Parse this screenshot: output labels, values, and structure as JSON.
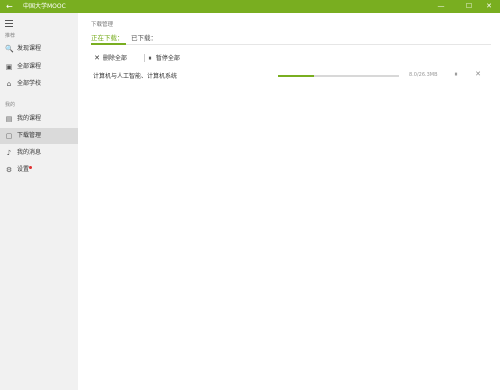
{
  "window": {
    "title": "中国大学MOOC",
    "back_icon": "←",
    "minimize_icon": "—",
    "maximize_icon": "☐",
    "close_icon": "✕",
    "accent_color": "#79ae20"
  },
  "sidebar": {
    "menu_icon": "hamburger-icon",
    "section_recommend": "推荐",
    "section_mine": "我的",
    "items": [
      {
        "label": "发现课程",
        "icon": "🔍",
        "icon_name": "search-icon"
      },
      {
        "label": "全部课程",
        "icon": "▣",
        "icon_name": "courses-icon"
      },
      {
        "label": "全部学校",
        "icon": "⌂",
        "icon_name": "school-icon"
      },
      {
        "label": "我的课程",
        "icon": "▤",
        "icon_name": "my-courses-icon"
      },
      {
        "label": "下载管理",
        "icon": "▢",
        "icon_name": "download-icon",
        "active": true
      },
      {
        "label": "我的消息",
        "icon": "♪",
        "icon_name": "bell-icon"
      },
      {
        "label": "设置",
        "icon": "⚙",
        "icon_name": "gear-icon",
        "notification_dot": true
      }
    ]
  },
  "main": {
    "title": "下载管理",
    "tabs": [
      {
        "label": "正在下载：",
        "active": true
      },
      {
        "label": "已下载：",
        "active": false
      }
    ],
    "actions": {
      "delete_all_icon": "✕",
      "delete_all": "删除全部",
      "pause_all_icon": "⏸",
      "pause_all": "暂停全部"
    },
    "downloads": [
      {
        "name": "计算机与人工智能、计算机系统",
        "size_text": "8.0/26.3MB",
        "progress": 0.3,
        "pause_icon": "⏸",
        "close_icon": "✕"
      }
    ]
  }
}
